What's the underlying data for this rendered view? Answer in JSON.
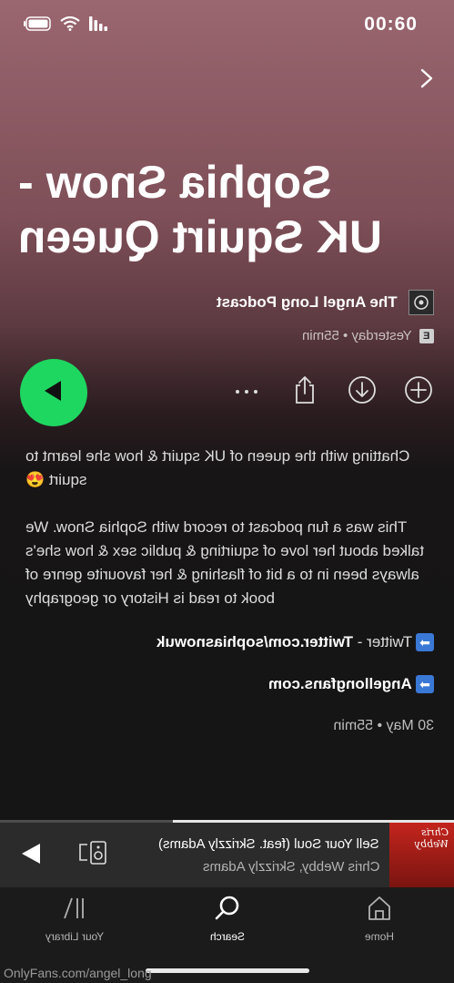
{
  "status_bar": {
    "time": "00:60"
  },
  "episode": {
    "title_line1": "Sophia Snow -",
    "title_line2": "UK Squirt Queen",
    "show_name": "The Angel Long Podcast",
    "explicit_badge": "E",
    "meta": "Yesterday • 55min"
  },
  "description": {
    "intro": "Chatting with the queen of UK squirt & how she learnt to squirt 😍",
    "body": "This was a fun podcast to record with Sophia Snow. We talked about her love of squirting & public sex & how she's always been in to a bit of flashing & her favourite genre of book to read is History or geography",
    "twitter_label": "Twitter - ",
    "twitter_link": "Twitter.com/sophiasnowuk",
    "fans_link": "Angellongfans.com",
    "footer": "30 May • 55min"
  },
  "mini_player": {
    "track": "Sell Your Soul (feat. Skrizzly Adams)",
    "artist": "Chris Webby, Skrizzly Adams",
    "art_text": "Chris Webby",
    "progress": 0.62
  },
  "tabs": {
    "home": "Home",
    "search": "Search",
    "library": "Your Library"
  },
  "watermark": "OnlyFans.com/angel_long",
  "colors": {
    "accent": "#1ed760",
    "background": "#121212"
  }
}
